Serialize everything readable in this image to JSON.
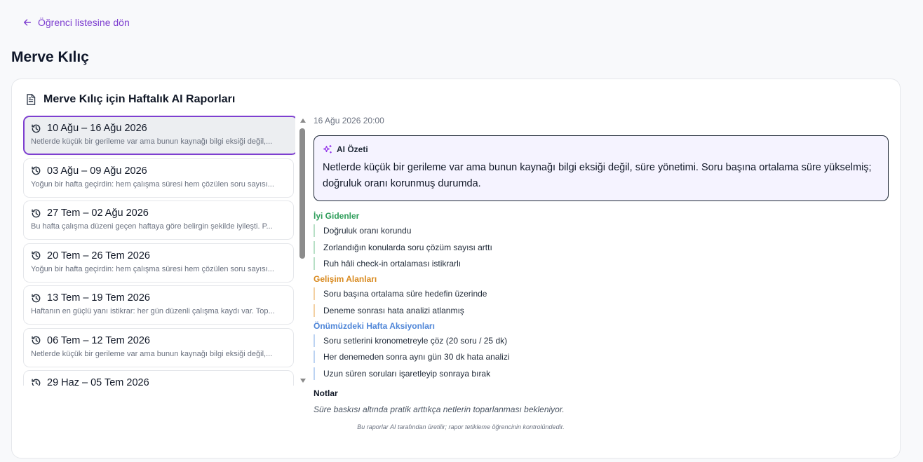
{
  "back_link": {
    "label": "Öğrenci listesine dön"
  },
  "page_title": "Merve Kılıç",
  "card": {
    "title": "Merve Kılıç için Haftalık AI Raporları"
  },
  "reports": [
    {
      "date": "10 Ağu – 16 Ağu 2026",
      "summary": "Netlerde küçük bir gerileme var ama bunun kaynağı bilgi eksiği değil,...",
      "active": true
    },
    {
      "date": "03 Ağu – 09 Ağu 2026",
      "summary": "Yoğun bir hafta geçirdin: hem çalışma süresi hem çözülen soru sayısı...",
      "active": false
    },
    {
      "date": "27 Tem – 02 Ağu 2026",
      "summary": "Bu hafta çalışma düzeni geçen haftaya göre belirgin şekilde iyileşti. P...",
      "active": false
    },
    {
      "date": "20 Tem – 26 Tem 2026",
      "summary": "Yoğun bir hafta geçirdin: hem çalışma süresi hem çözülen soru sayısı...",
      "active": false
    },
    {
      "date": "13 Tem – 19 Tem 2026",
      "summary": "Haftanın en güçlü yanı istikrar: her gün düzenli çalışma kaydı var. Top...",
      "active": false
    },
    {
      "date": "06 Tem – 12 Tem 2026",
      "summary": "Netlerde küçük bir gerileme var ama bunun kaynağı bilgi eksiği değil,...",
      "active": false
    },
    {
      "date": "29 Haz – 05 Tem 2026",
      "summary": "",
      "active": false
    }
  ],
  "detail": {
    "timestamp": "16 Ağu 2026 20:00",
    "ai_summary": {
      "label": "AI Özeti",
      "text": "Netlerde küçük bir gerileme var ama bunun kaynağı bilgi eksiği değil, süre yönetimi. Soru başına ortalama süre yükselmiş; doğruluk oranı korunmuş durumda."
    },
    "going_well": {
      "title": "İyi Gidenler",
      "items": [
        "Doğruluk oranı korundu",
        "Zorlandığın konularda soru çözüm sayısı arttı",
        "Ruh hâli check-in ortalaması istikrarlı"
      ]
    },
    "improvement": {
      "title": "Gelişim Alanları",
      "items": [
        "Soru başına ortalama süre hedefin üzerinde",
        "Deneme sonrası hata analizi atlanmış"
      ]
    },
    "next_week": {
      "title": "Önümüzdeki Hafta Aksiyonları",
      "items": [
        "Soru setlerini kronometreyle çöz (20 soru / 25 dk)",
        "Her denemeden sonra aynı gün 30 dk hata analizi",
        "Uzun süren soruları işaretleyip sonraya bırak"
      ]
    },
    "notes": {
      "title": "Notlar",
      "text": "Süre baskısı altında pratik arttıkça netlerin toparlanması bekleniyor."
    },
    "footer": "Bu raporlar AI tarafından üretilir; rapor tetikleme öğrencinin kontrolündedir."
  },
  "colors": {
    "accent": "#7e3fd0",
    "going_well": "#2f9e5b",
    "improvement": "#d98a1f",
    "next_week": "#4f86d8"
  }
}
